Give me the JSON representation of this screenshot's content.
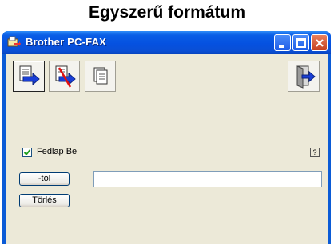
{
  "heading": "Egyszerű formátum",
  "window": {
    "title": "Brother PC-FAX"
  },
  "toolbar": {
    "buttons": [
      {
        "icon": "send-fax-icon"
      },
      {
        "icon": "cancel-send-icon"
      },
      {
        "icon": "document-icon"
      },
      {
        "icon": "exit-icon"
      }
    ]
  },
  "cover_page": {
    "label": "Fedlap Be",
    "checked": true
  },
  "help": {
    "label": "?"
  },
  "from_button": {
    "label": "-tól"
  },
  "from_field": {
    "value": "",
    "placeholder": ""
  },
  "delete_button": {
    "label": "Törlés"
  },
  "colors": {
    "titlebar": "#0551e0",
    "client": "#ece9d8",
    "close": "#c6401f"
  }
}
